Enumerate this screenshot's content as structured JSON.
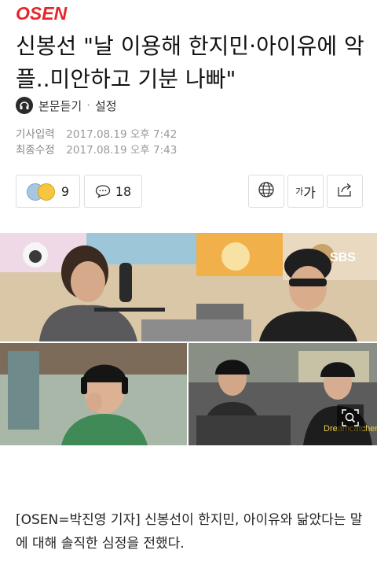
{
  "header": {
    "logo_text": "OSEN"
  },
  "article": {
    "title": "신봉선 \"날 이용해 한지민·아이유에 악플..미안하고 기분 나빠\"",
    "audio_label": "본문듣기",
    "separator": "·",
    "settings_label": "설정",
    "published_label": "기사입력",
    "published_value": "2017.08.19 오후 7:42",
    "modified_label": "최종수정",
    "modified_value": "2017.08.19 오후 7:43",
    "reaction_count": "9",
    "comment_count": "18",
    "font_label_small": "가",
    "font_label_big": "가",
    "body": "[OSEN=박진영 기자] 신봉선이 한지민, 아이유와 닮았다는 말에 대해 솔직한 심정을 전했다.",
    "photo_watermark": "SBS"
  },
  "colors": {
    "brand": "#e8242a",
    "muted": "#888888",
    "border": "#dddddd"
  },
  "icons": {
    "audio": "headphones-icon",
    "react": "emoji-reaction-icon",
    "comment": "speech-bubble-icon",
    "translate": "globe-icon",
    "share": "share-icon",
    "zoom": "zoom-icon"
  }
}
